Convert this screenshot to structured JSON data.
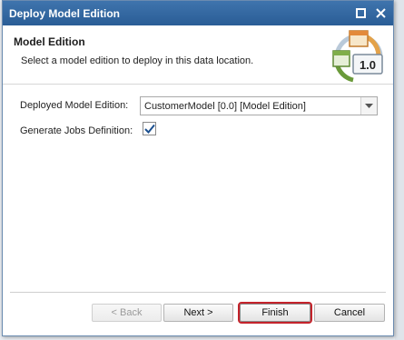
{
  "dialog": {
    "title": "Deploy Model Edition",
    "header_title": "Model Edition",
    "header_desc": "Select a model edition to deploy in this data location.",
    "logo_version": "1.0"
  },
  "form": {
    "deployed_label": "Deployed Model Edition:",
    "deployed_value": "CustomerModel [0.0] [Model Edition]",
    "generate_label": "Generate Jobs Definition:",
    "generate_checked": true
  },
  "buttons": {
    "back": "< Back",
    "next": "Next >",
    "finish": "Finish",
    "cancel": "Cancel"
  },
  "colors": {
    "titlebar": "#2f639d",
    "focus_outline": "#c4232b",
    "check": "#1a4f8f"
  }
}
